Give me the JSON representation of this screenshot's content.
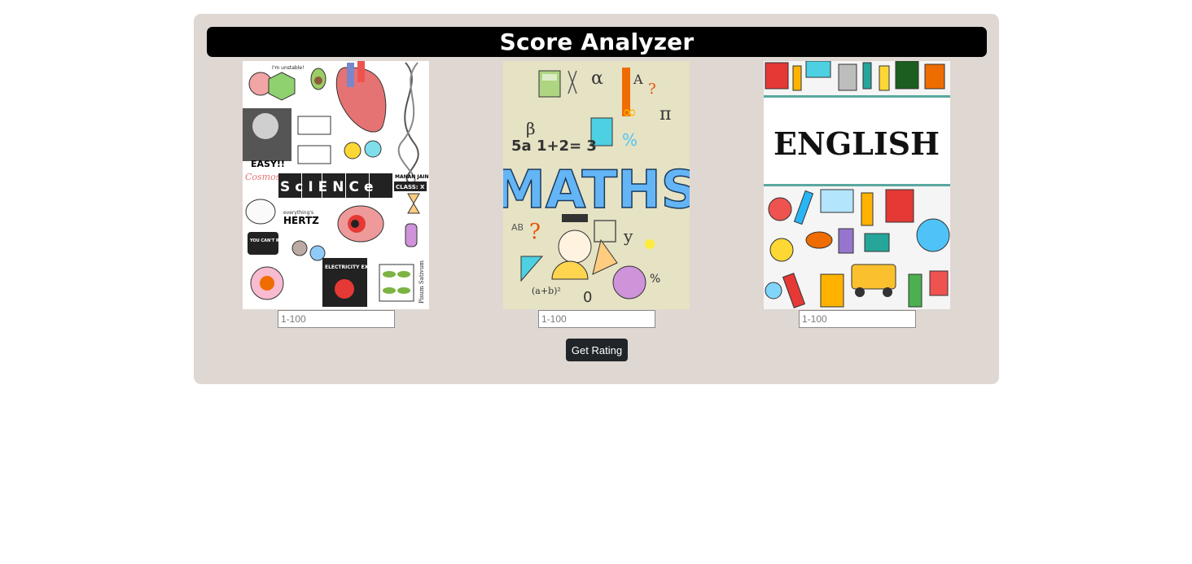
{
  "header": {
    "title": "Score Analyzer"
  },
  "subjects": [
    {
      "name": "science",
      "cover_text": "ScIENCe",
      "input_placeholder": "1-100",
      "input_value": ""
    },
    {
      "name": "maths",
      "cover_text": "MATHS",
      "input_placeholder": "1-100",
      "input_value": ""
    },
    {
      "name": "english",
      "cover_text": "ENGLISH",
      "input_placeholder": "1-100",
      "input_value": ""
    }
  ],
  "science_cover": {
    "unstable": "I'm unstable!",
    "easy": "EASY!!",
    "cosmos": "Cosmos",
    "class_label": "CLASS: X",
    "name_label": "MANAN JAIN",
    "hertz_top": "everything's",
    "hertz": "HERTZ",
    "resist": "YOU CAN'T RESIST ME",
    "electricity": "ELECTRICITY EXPLAINED",
    "pisum": "Pisum Sativum"
  },
  "maths_cover": {
    "equation": "5a 1+2= 3",
    "pi": "π",
    "percent": "%"
  },
  "actions": {
    "get_rating_label": "Get Rating"
  },
  "colors": {
    "card_bg": "#dfd7d2",
    "header_bg": "#000000",
    "button_bg": "#212529"
  }
}
